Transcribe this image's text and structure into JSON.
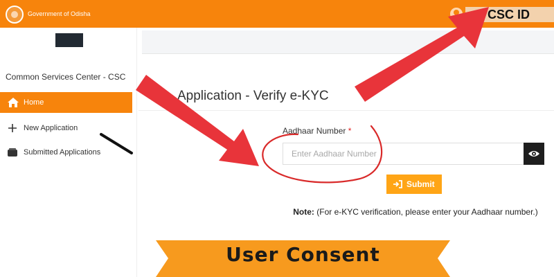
{
  "header": {
    "gov_title": "Government of Odisha",
    "csc_id_label": "CSC ID"
  },
  "sidebar": {
    "title": "Common Services Center - CSC",
    "items": [
      {
        "label": "Home",
        "icon": "home-icon",
        "active": true
      },
      {
        "label": "New Application",
        "icon": "plus-icon",
        "active": false
      },
      {
        "label": "Submitted Applications",
        "icon": "inbox-icon",
        "active": false
      }
    ]
  },
  "main": {
    "page_title": "Application - Verify e-KYC",
    "aadhaar_label": "Aadhaar Number",
    "required_mark": "*",
    "aadhaar_placeholder": "Enter Aadhaar Number",
    "submit_label": "Submit",
    "note_bold": "Note:",
    "note_text": " (For e-KYC verification, please enter your Aadhaar number.)"
  },
  "annotation": {
    "banner_text": "User Consent"
  },
  "colors": {
    "brand_orange": "#f7840c",
    "button_orange": "#ffa516",
    "arrow_red": "#e8343a",
    "banner_orange": "#f79a1e"
  }
}
